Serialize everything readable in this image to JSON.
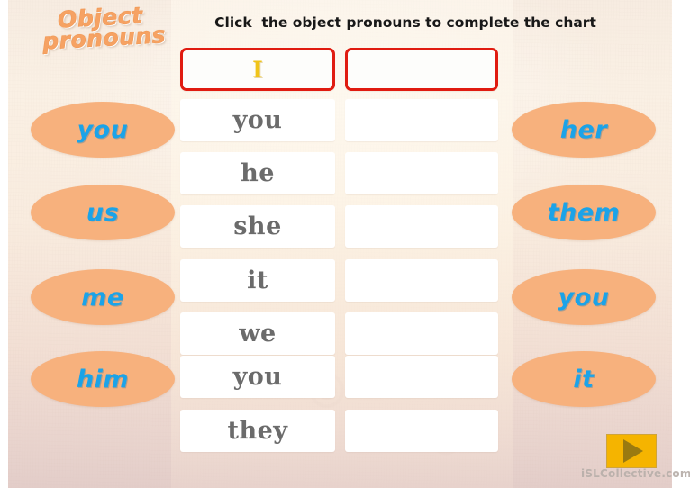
{
  "slide": {
    "title_line1": "Object",
    "title_line2": "pronouns",
    "instruction": "Click  the object pronouns to complete the chart"
  },
  "chart": {
    "header_left_value": "I",
    "header_right_value": "",
    "rows": [
      {
        "subject": "you",
        "object": ""
      },
      {
        "subject": "he",
        "object": ""
      },
      {
        "subject": "she",
        "object": ""
      },
      {
        "subject": "it",
        "object": ""
      },
      {
        "subject": "we",
        "object": ""
      },
      {
        "subject": "you",
        "object": ""
      },
      {
        "subject": "they",
        "object": ""
      }
    ]
  },
  "answers": {
    "left": [
      {
        "label": "you"
      },
      {
        "label": "us"
      },
      {
        "label": "me"
      },
      {
        "label": "him"
      }
    ],
    "right": [
      {
        "label": "her"
      },
      {
        "label": "them"
      },
      {
        "label": "you"
      },
      {
        "label": "it"
      }
    ]
  },
  "footer": {
    "watermark": "iSLCollective.com"
  },
  "colors": {
    "oval_fill": "#f7b17d",
    "oval_text": "#1ba3e8",
    "title": "#f6a263",
    "header_border": "#e01b10",
    "subject_text": "#6b6b6b",
    "pronoun_i": "#f0c419",
    "play_button": "#f5b400"
  }
}
